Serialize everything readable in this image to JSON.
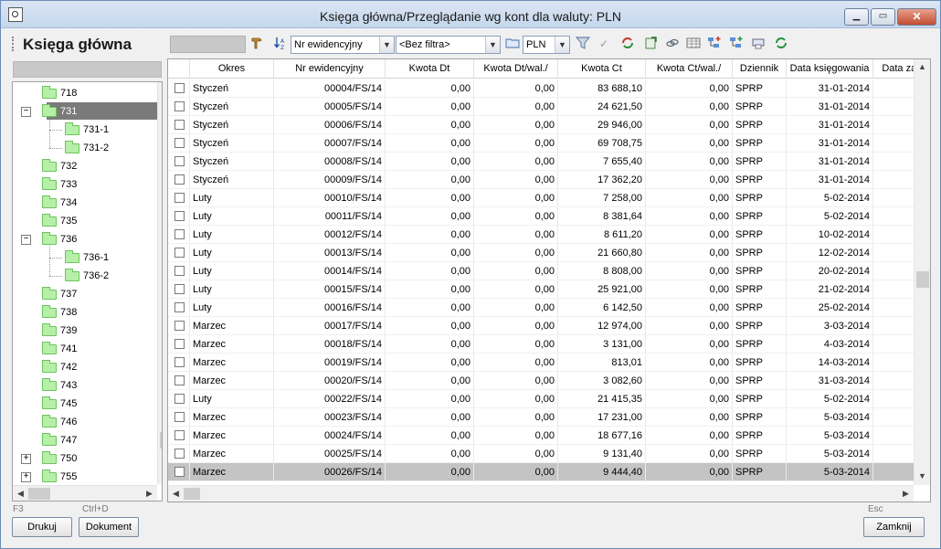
{
  "window": {
    "title": "Księga główna/Przeglądanie wg kont dla waluty: PLN",
    "minimize": "▁",
    "maximize": "▭",
    "close": "✕"
  },
  "toolbar": {
    "heading": "Księga główna",
    "sort_combo": "Nr ewidencyjny",
    "filter_combo": "<Bez filtra>",
    "currency_combo": "PLN",
    "icons": [
      "hammer-icon",
      "sort-icon",
      "folder-icon",
      "filter-icon",
      "check-icon",
      "refresh-red-icon",
      "export-icon",
      "link-icon",
      "grid-icon",
      "tree-add-icon",
      "tree-add-2-icon",
      "print-preview-icon",
      "refresh-green-icon"
    ]
  },
  "tree": {
    "items": [
      {
        "label": "718",
        "level": 0,
        "expander": ""
      },
      {
        "label": "731",
        "level": 0,
        "expander": "−",
        "selected": true
      },
      {
        "label": "731-1",
        "level": 1,
        "expander": ""
      },
      {
        "label": "731-2",
        "level": 1,
        "expander": ""
      },
      {
        "label": "732",
        "level": 0,
        "expander": ""
      },
      {
        "label": "733",
        "level": 0,
        "expander": ""
      },
      {
        "label": "734",
        "level": 0,
        "expander": ""
      },
      {
        "label": "735",
        "level": 0,
        "expander": ""
      },
      {
        "label": "736",
        "level": 0,
        "expander": "−"
      },
      {
        "label": "736-1",
        "level": 1,
        "expander": ""
      },
      {
        "label": "736-2",
        "level": 1,
        "expander": ""
      },
      {
        "label": "737",
        "level": 0,
        "expander": ""
      },
      {
        "label": "738",
        "level": 0,
        "expander": ""
      },
      {
        "label": "739",
        "level": 0,
        "expander": ""
      },
      {
        "label": "741",
        "level": 0,
        "expander": ""
      },
      {
        "label": "742",
        "level": 0,
        "expander": ""
      },
      {
        "label": "743",
        "level": 0,
        "expander": ""
      },
      {
        "label": "745",
        "level": 0,
        "expander": ""
      },
      {
        "label": "746",
        "level": 0,
        "expander": ""
      },
      {
        "label": "747",
        "level": 0,
        "expander": ""
      },
      {
        "label": "750",
        "level": 0,
        "expander": "+"
      },
      {
        "label": "755",
        "level": 0,
        "expander": "+"
      }
    ]
  },
  "grid": {
    "columns": [
      "",
      "Okres",
      "Nr ewidencyjny",
      "Kwota Dt",
      "Kwota Dt/wal./",
      "Kwota Ct",
      "Kwota Ct/wal./",
      "Dziennik",
      "Data księgowania",
      "Data zał"
    ],
    "rows": [
      [
        "Styczeń",
        "00004/FS/14",
        "0,00",
        "0,00",
        "83 688,10",
        "0,00",
        "SPRP",
        "31-01-2014"
      ],
      [
        "Styczeń",
        "00005/FS/14",
        "0,00",
        "0,00",
        "24 621,50",
        "0,00",
        "SPRP",
        "31-01-2014"
      ],
      [
        "Styczeń",
        "00006/FS/14",
        "0,00",
        "0,00",
        "29 946,00",
        "0,00",
        "SPRP",
        "31-01-2014"
      ],
      [
        "Styczeń",
        "00007/FS/14",
        "0,00",
        "0,00",
        "69 708,75",
        "0,00",
        "SPRP",
        "31-01-2014"
      ],
      [
        "Styczeń",
        "00008/FS/14",
        "0,00",
        "0,00",
        "7 655,40",
        "0,00",
        "SPRP",
        "31-01-2014"
      ],
      [
        "Styczeń",
        "00009/FS/14",
        "0,00",
        "0,00",
        "17 362,20",
        "0,00",
        "SPRP",
        "31-01-2014"
      ],
      [
        "Luty",
        "00010/FS/14",
        "0,00",
        "0,00",
        "7 258,00",
        "0,00",
        "SPRP",
        "5-02-2014"
      ],
      [
        "Luty",
        "00011/FS/14",
        "0,00",
        "0,00",
        "8 381,64",
        "0,00",
        "SPRP",
        "5-02-2014"
      ],
      [
        "Luty",
        "00012/FS/14",
        "0,00",
        "0,00",
        "8 611,20",
        "0,00",
        "SPRP",
        "10-02-2014"
      ],
      [
        "Luty",
        "00013/FS/14",
        "0,00",
        "0,00",
        "21 660,80",
        "0,00",
        "SPRP",
        "12-02-2014"
      ],
      [
        "Luty",
        "00014/FS/14",
        "0,00",
        "0,00",
        "8 808,00",
        "0,00",
        "SPRP",
        "20-02-2014"
      ],
      [
        "Luty",
        "00015/FS/14",
        "0,00",
        "0,00",
        "25 921,00",
        "0,00",
        "SPRP",
        "21-02-2014"
      ],
      [
        "Luty",
        "00016/FS/14",
        "0,00",
        "0,00",
        "6 142,50",
        "0,00",
        "SPRP",
        "25-02-2014"
      ],
      [
        "Marzec",
        "00017/FS/14",
        "0,00",
        "0,00",
        "12 974,00",
        "0,00",
        "SPRP",
        "3-03-2014"
      ],
      [
        "Marzec",
        "00018/FS/14",
        "0,00",
        "0,00",
        "3 131,00",
        "0,00",
        "SPRP",
        "4-03-2014"
      ],
      [
        "Marzec",
        "00019/FS/14",
        "0,00",
        "0,00",
        "813,01",
        "0,00",
        "SPRP",
        "14-03-2014"
      ],
      [
        "Marzec",
        "00020/FS/14",
        "0,00",
        "0,00",
        "3 082,60",
        "0,00",
        "SPRP",
        "31-03-2014"
      ],
      [
        "Luty",
        "00022/FS/14",
        "0,00",
        "0,00",
        "21 415,35",
        "0,00",
        "SPRP",
        "5-02-2014"
      ],
      [
        "Marzec",
        "00023/FS/14",
        "0,00",
        "0,00",
        "17 231,00",
        "0,00",
        "SPRP",
        "5-03-2014"
      ],
      [
        "Marzec",
        "00024/FS/14",
        "0,00",
        "0,00",
        "18 677,16",
        "0,00",
        "SPRP",
        "5-03-2014"
      ],
      [
        "Marzec",
        "00025/FS/14",
        "0,00",
        "0,00",
        "9 131,40",
        "0,00",
        "SPRP",
        "5-03-2014"
      ],
      [
        "Marzec",
        "00026/FS/14",
        "0,00",
        "0,00",
        "9 444,40",
        "0,00",
        "SPRP",
        "5-03-2014"
      ]
    ],
    "selected_row": 21
  },
  "footer": {
    "print_shortcut": "F3",
    "print_label": "Drukuj",
    "document_shortcut": "Ctrl+D",
    "document_label": "Dokument",
    "close_shortcut": "Esc",
    "close_label": "Zamknij"
  }
}
